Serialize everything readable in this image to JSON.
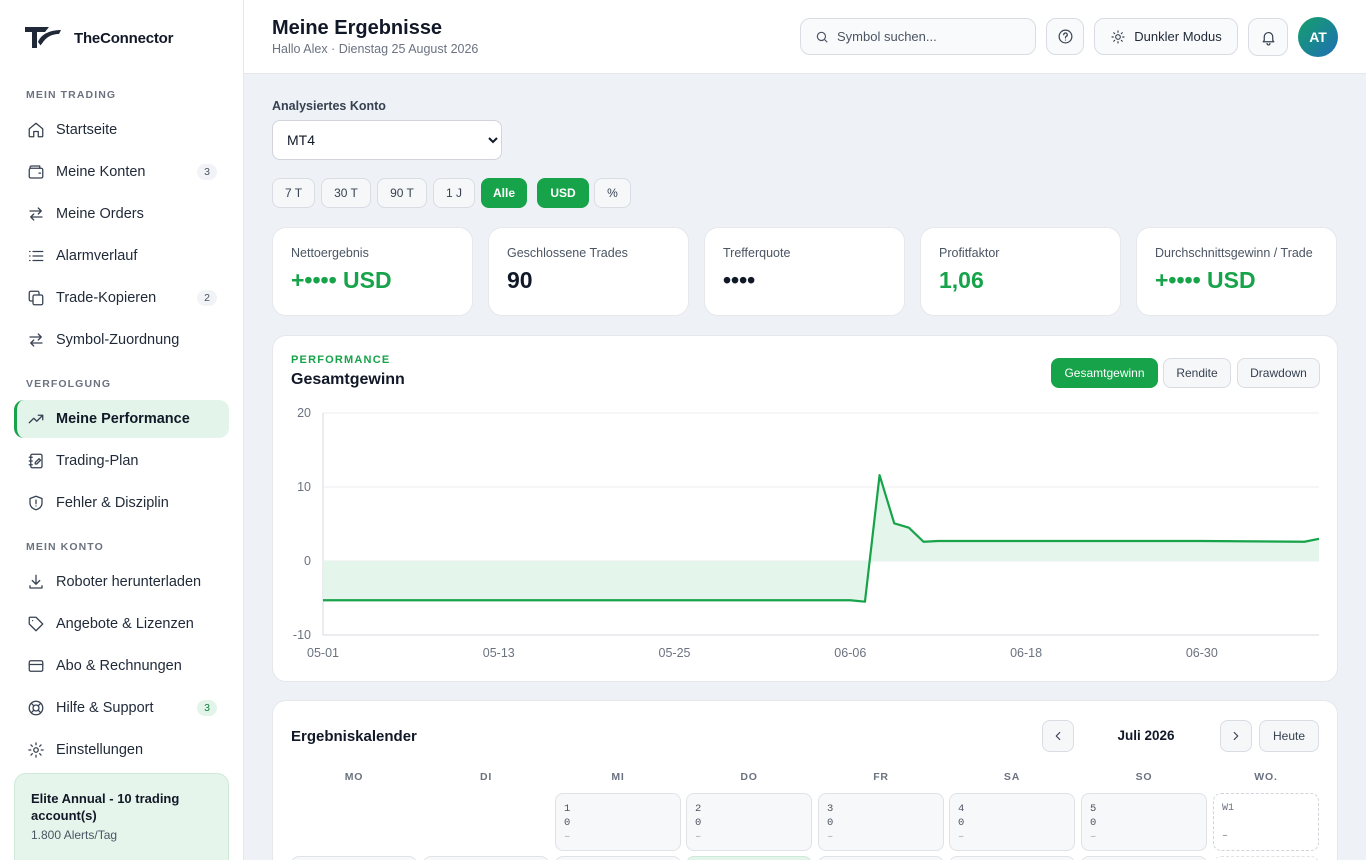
{
  "brand": {
    "name": "TheConnector"
  },
  "sidebar": {
    "sections": [
      {
        "label": "MEIN TRADING"
      },
      {
        "label": "VERFOLGUNG"
      },
      {
        "label": "MEIN KONTO"
      }
    ],
    "items": [
      {
        "label": "Startseite",
        "icon": "home-icon"
      },
      {
        "label": "Meine Konten",
        "icon": "wallet-icon",
        "badge": "3"
      },
      {
        "label": "Meine Orders",
        "icon": "arrows-swap-icon"
      },
      {
        "label": "Alarmverlauf",
        "icon": "list-icon"
      },
      {
        "label": "Trade-Kopieren",
        "icon": "copy-icon",
        "badge": "2"
      },
      {
        "label": "Symbol-Zuordnung",
        "icon": "arrows-swap-icon"
      },
      {
        "label": "Meine Performance",
        "icon": "trending-up-icon",
        "active": true
      },
      {
        "label": "Trading-Plan",
        "icon": "notebook-icon"
      },
      {
        "label": "Fehler & Disziplin",
        "icon": "shield-icon"
      },
      {
        "label": "Roboter herunterladen",
        "icon": "download-icon"
      },
      {
        "label": "Angebote & Lizenzen",
        "icon": "tag-icon"
      },
      {
        "label": "Abo & Rechnungen",
        "icon": "credit-card-icon"
      },
      {
        "label": "Hilfe & Support",
        "icon": "lifebuoy-icon",
        "badge": "3"
      },
      {
        "label": "Einstellungen",
        "icon": "gear-icon"
      }
    ],
    "plan": {
      "title": "Elite Annual - 10 trading account(s)",
      "subtitle": "1.800 Alerts/Tag"
    }
  },
  "header": {
    "title": "Meine Ergebnisse",
    "subtitle": "Hallo Alex · Dienstag 25 August 2026",
    "search_placeholder": "Symbol suchen...",
    "dark_mode_label": "Dunkler Modus",
    "avatar_initials": "AT"
  },
  "filters": {
    "account_label": "Analysiertes Konto",
    "account_options": [
      "MT4"
    ],
    "account_selected": "MT4",
    "periods": [
      "7 T",
      "30 T",
      "90 T",
      "1 J",
      "Alle"
    ],
    "active_period": "Alle",
    "units": [
      "USD",
      "%"
    ],
    "active_unit": "USD"
  },
  "stats": [
    {
      "label": "Nettoergebnis",
      "value": "+•••• USD",
      "accent": "#16a34a"
    },
    {
      "label": "Geschlossene Trades",
      "value": "90"
    },
    {
      "label": "Trefferquote",
      "value": "••••"
    },
    {
      "label": "Profitfaktor",
      "value": "1,06",
      "accent": "#16a34a"
    },
    {
      "label": "Durchschnittsgewinn / Trade",
      "value": "+•••• USD",
      "accent": "#16a34a"
    }
  ],
  "performance": {
    "kicker": "PERFORMANCE",
    "title": "Gesamtgewinn",
    "tabs": [
      "Gesamtgewinn",
      "Rendite",
      "Drawdown"
    ],
    "active_tab": "Gesamtgewinn"
  },
  "chart_data": {
    "type": "area",
    "title": "Gesamtgewinn",
    "xlabel": "",
    "ylabel": "",
    "ylim": [
      -10,
      20
    ],
    "yticks": [
      20,
      10,
      0,
      -10
    ],
    "xticks": [
      "05-01",
      "05-13",
      "05-25",
      "06-06",
      "06-18",
      "06-30"
    ],
    "grid": true,
    "line_color": "#16a34a",
    "fill_color": "#e3f4ea",
    "x": [
      "05-01",
      "05-13",
      "05-25",
      "06-06",
      "06-07",
      "06-08",
      "06-09",
      "06-10",
      "06-11",
      "06-12",
      "06-18",
      "06-24",
      "06-30",
      "07-07",
      "07-08"
    ],
    "series": [
      {
        "values": [
          -5.3,
          -5.3,
          -5.3,
          -5.3,
          -5.5,
          11.6,
          5.1,
          4.5,
          2.6,
          2.7,
          2.7,
          2.7,
          2.7,
          2.6,
          3.0
        ]
      }
    ]
  },
  "calendar": {
    "title": "Ergebniskalender",
    "month": "Juli 2026",
    "today_label": "Heute",
    "weekdays": [
      "MO",
      "DI",
      "MI",
      "DO",
      "FR",
      "SA",
      "SO",
      "WO."
    ],
    "days": [
      {
        "day": "1",
        "value": "0",
        "trades": "–"
      },
      {
        "day": "2",
        "value": "0",
        "trades": "–"
      },
      {
        "day": "3",
        "value": "0",
        "trades": "–"
      },
      {
        "day": "4",
        "value": "0",
        "trades": "–"
      },
      {
        "day": "5",
        "value": "0",
        "trades": "–"
      }
    ],
    "week": {
      "label": "W1",
      "value": "–"
    }
  }
}
